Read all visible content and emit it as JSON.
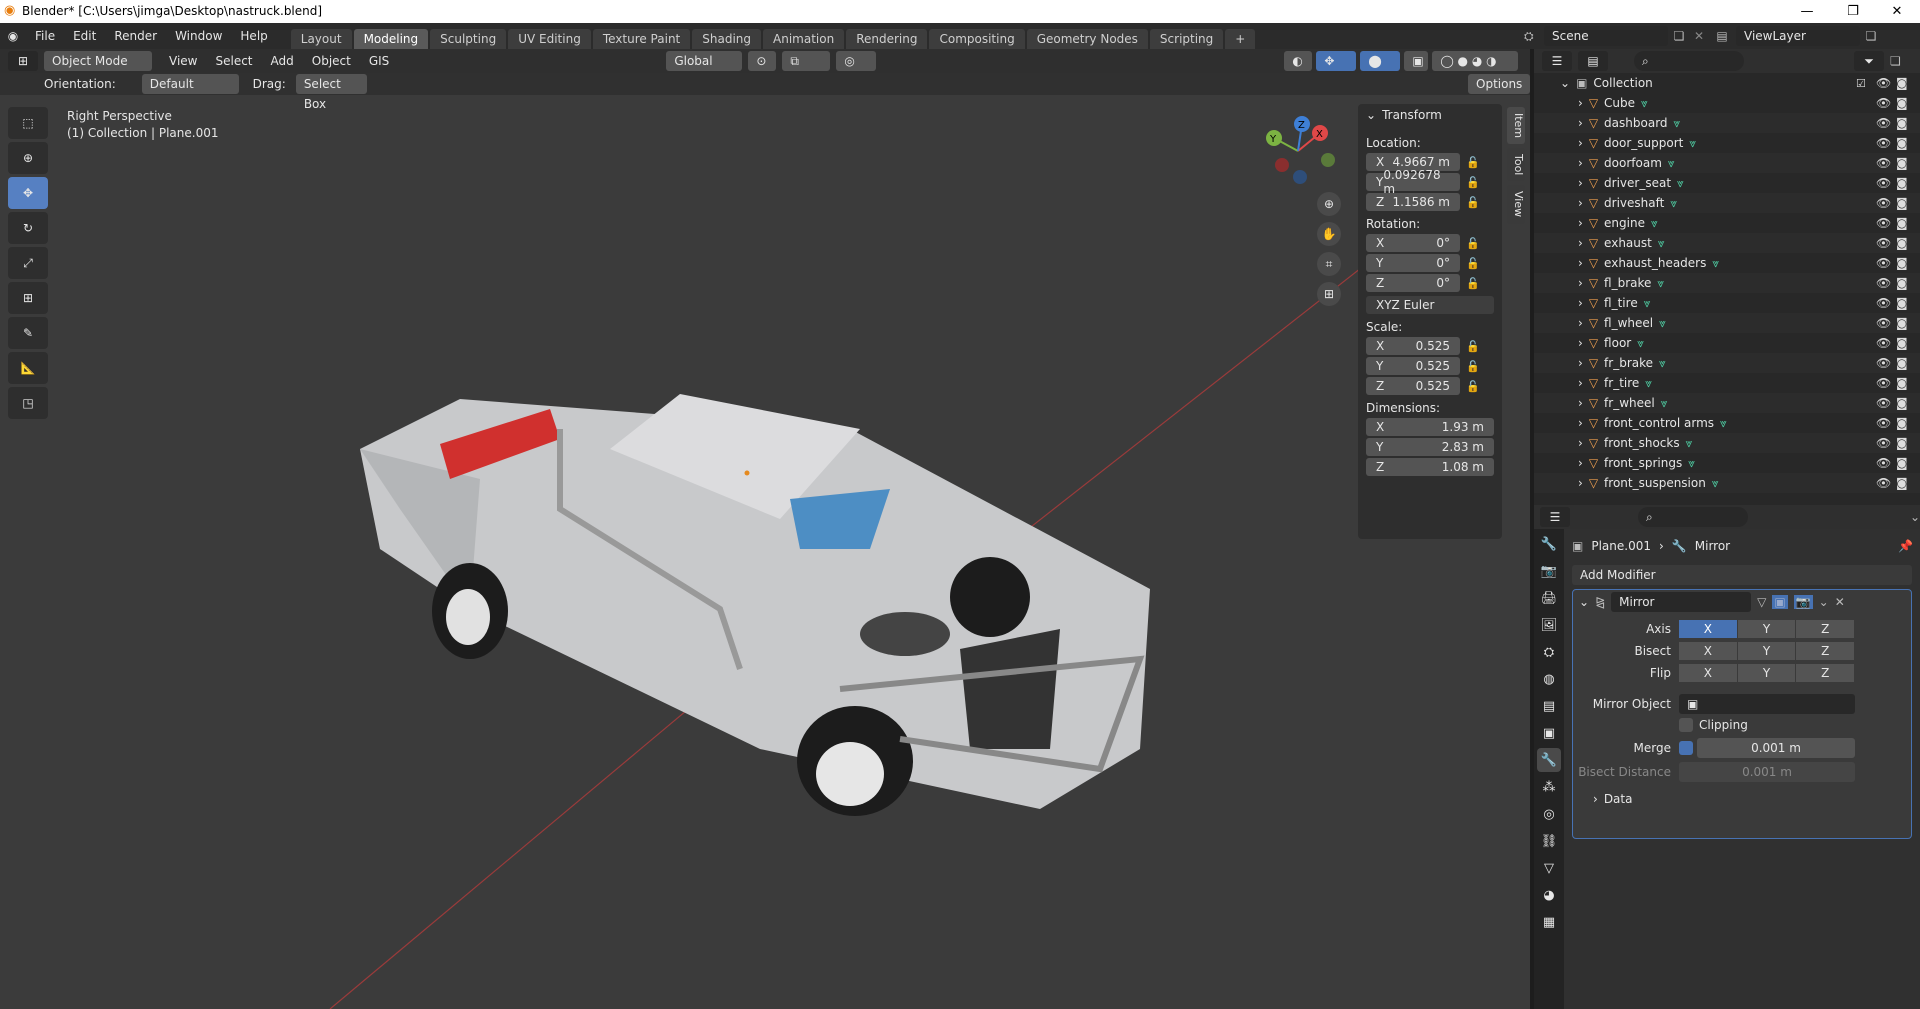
{
  "window": {
    "title": "Blender* [C:\\Users\\jimga\\Desktop\\nastruck.blend]",
    "minimize": "—",
    "maximize": "❐",
    "close": "✕"
  },
  "menu": [
    "File",
    "Edit",
    "Render",
    "Window",
    "Help"
  ],
  "workspaces": [
    "Layout",
    "Modeling",
    "Sculpting",
    "UV Editing",
    "Texture Paint",
    "Shading",
    "Animation",
    "Rendering",
    "Compositing",
    "Geometry Nodes",
    "Scripting"
  ],
  "active_workspace": "Modeling",
  "scene": {
    "name": "Scene",
    "view_layer": "ViewLayer"
  },
  "viewport": {
    "mode": "Object Mode",
    "menu": [
      "View",
      "Select",
      "Add",
      "Object",
      "GIS"
    ],
    "transform_orientation": "Global",
    "orientation_label": "Orientation:",
    "orientation_value": "Default",
    "drag_label": "Drag:",
    "drag_value": "Select Box",
    "options": "Options",
    "view_name": "Right Perspective",
    "view_info": "(1) Collection | Plane.001"
  },
  "npanel": {
    "tabs": [
      "Item",
      "Tool",
      "View"
    ],
    "header": "Transform",
    "location_label": "Location:",
    "location": {
      "x": "4.9667 m",
      "y": "0.092678 m",
      "z": "1.1586 m"
    },
    "rotation_label": "Rotation:",
    "rotation": {
      "x": "0°",
      "y": "0°",
      "z": "0°"
    },
    "rotation_mode": "XYZ Euler",
    "scale_label": "Scale:",
    "scale": {
      "x": "0.525",
      "y": "0.525",
      "z": "0.525"
    },
    "dimensions_label": "Dimensions:",
    "dimensions": {
      "x": "1.93 m",
      "y": "2.83 m",
      "z": "1.08 m"
    },
    "axis": {
      "x": "X",
      "y": "Y",
      "z": "Z"
    }
  },
  "outliner": {
    "collection": "Collection",
    "items": [
      "Cube",
      "dashboard",
      "door_support",
      "doorfoam",
      "driver_seat",
      "driveshaft",
      "engine",
      "exhaust",
      "exhaust_headers",
      "fl_brake",
      "fl_tire",
      "fl_wheel",
      "floor",
      "fr_brake",
      "fr_tire",
      "fr_wheel",
      "front_control arms",
      "front_shocks",
      "front_springs",
      "front_suspension"
    ]
  },
  "properties": {
    "object": "Plane.001",
    "modifier": "Mirror",
    "add_modifier": "Add Modifier",
    "modifier_name": "Mirror",
    "axis_label": "Axis",
    "bisect_label": "Bisect",
    "flip_label": "Flip",
    "axes": [
      "X",
      "Y",
      "Z"
    ],
    "mirror_object_label": "Mirror Object",
    "clipping": "Clipping",
    "merge_label": "Merge",
    "merge_value": "0.001 m",
    "bisect_distance_label": "Bisect Distance",
    "bisect_distance_value": "0.001 m",
    "data": "Data"
  },
  "colors": {
    "accent": "#4772b3",
    "header": "#2b2b2b",
    "viewport": "#3b3b3b"
  }
}
